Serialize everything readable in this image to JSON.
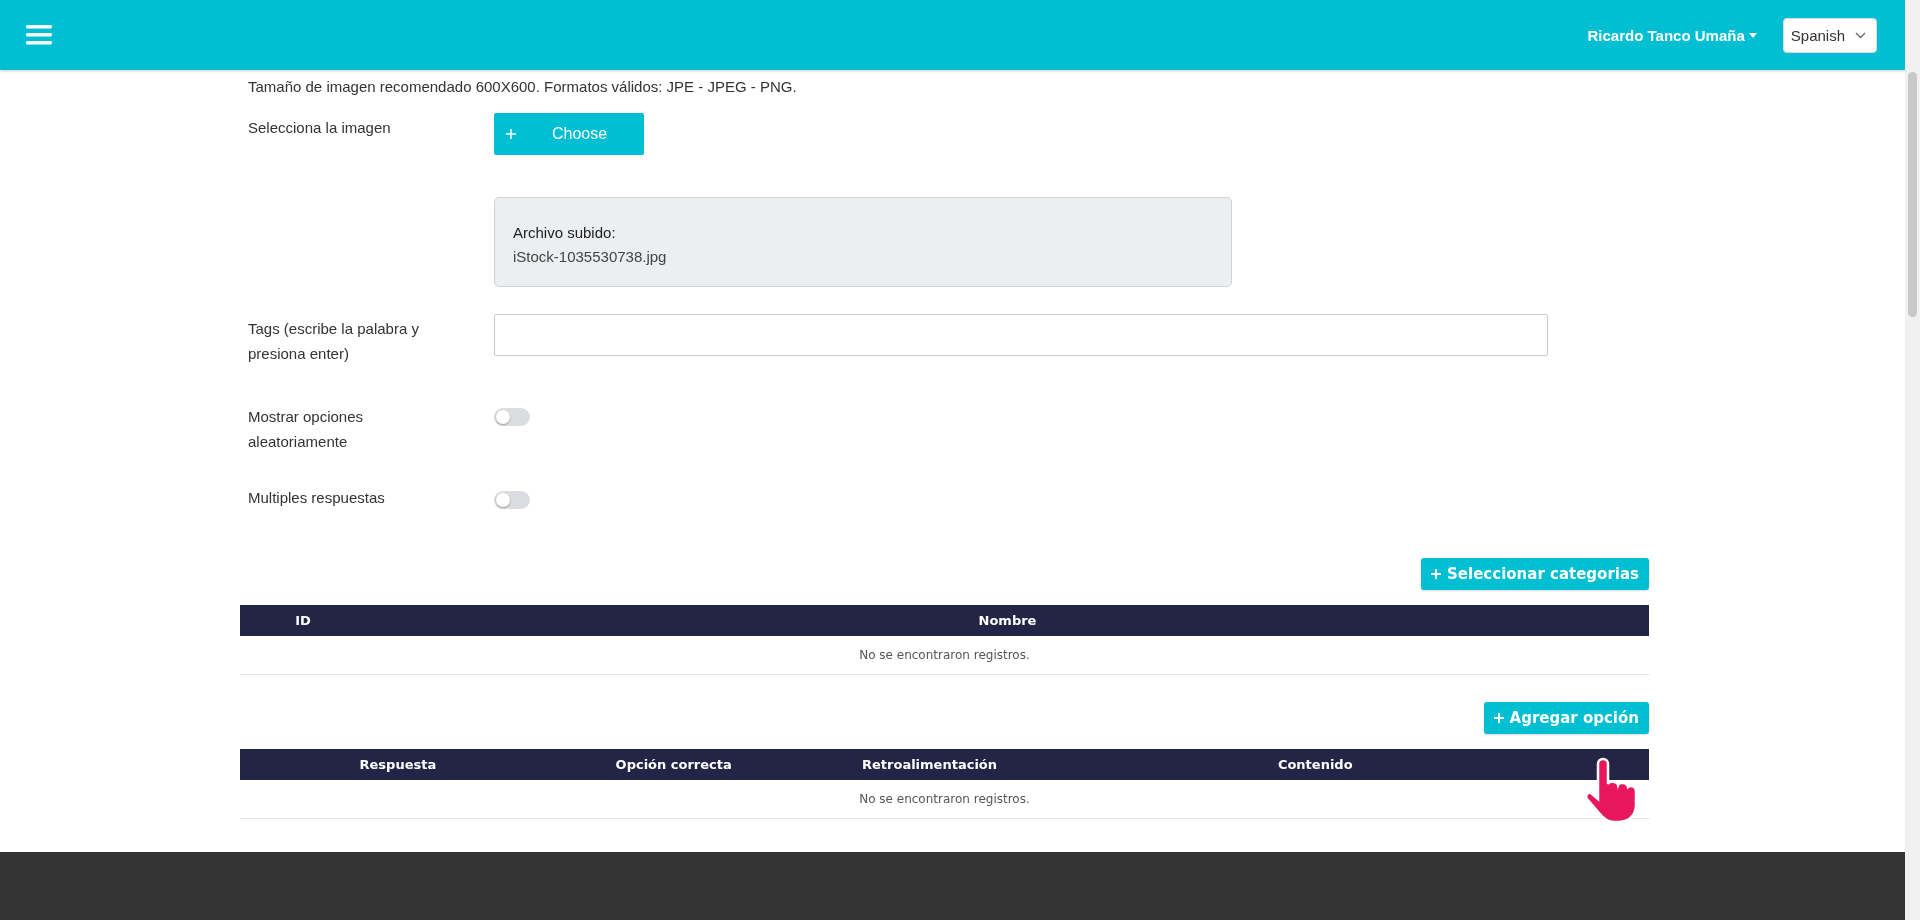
{
  "header": {
    "user": "Ricardo Tanco Umaña",
    "language": "Spanish"
  },
  "image_hint": "Tamaño de imagen recomendado 600X600. Formatos válidos: JPE - JPEG - PNG.",
  "image": {
    "label": "Selecciona la imagen",
    "button": "Choose",
    "uploaded_label": "Archivo subido:",
    "uploaded_file": "iStock-1035530738.jpg"
  },
  "tags": {
    "label": "Tags (escribe la palabra y presiona enter)"
  },
  "toggles": [
    {
      "label": "Mostrar opciones aleatoriamente",
      "on": false
    },
    {
      "label": "Multiples respuestas",
      "on": false
    }
  ],
  "categories": {
    "button": "Seleccionar categorias",
    "columns": [
      "ID",
      "Nombre"
    ],
    "empty": "No se encontraron registros."
  },
  "options": {
    "button": "Agregar opción",
    "columns": [
      "Respuesta",
      "Opción correcta",
      "Retroalimentación",
      "Contenido"
    ],
    "empty": "No se encontraron registros."
  }
}
